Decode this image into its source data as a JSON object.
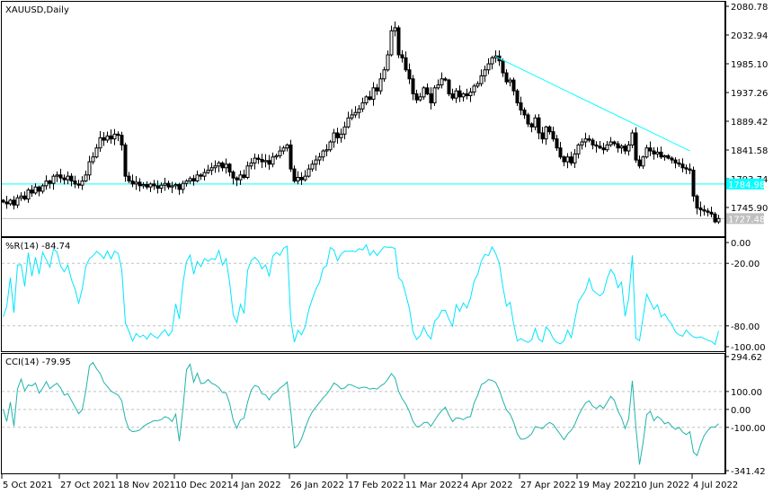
{
  "chart_data": [
    {
      "type": "candlestick",
      "title": "XAUUSD,Daily",
      "symbol": "XAUUSD",
      "timeframe": "Daily",
      "open_rule": "each open equals previous close",
      "close": [
        1755,
        1752,
        1758,
        1750,
        1762,
        1765,
        1760,
        1775,
        1770,
        1780,
        1773,
        1782,
        1790,
        1786,
        1798,
        1800,
        1795,
        1792,
        1798,
        1790,
        1785,
        1783,
        1790,
        1800,
        1822,
        1830,
        1845,
        1862,
        1858,
        1865,
        1860,
        1868,
        1866,
        1850,
        1798,
        1790,
        1785,
        1788,
        1782,
        1784,
        1780,
        1785,
        1782,
        1778,
        1783,
        1786,
        1780,
        1782,
        1784,
        1776,
        1786,
        1790,
        1794,
        1790,
        1800,
        1798,
        1804,
        1808,
        1812,
        1815,
        1820,
        1812,
        1818,
        1805,
        1795,
        1792,
        1800,
        1796,
        1815,
        1820,
        1828,
        1826,
        1822,
        1824,
        1818,
        1830,
        1832,
        1840,
        1845,
        1850,
        1810,
        1790,
        1796,
        1792,
        1798,
        1810,
        1818,
        1825,
        1830,
        1840,
        1842,
        1855,
        1870,
        1862,
        1868,
        1880,
        1895,
        1900,
        1904,
        1910,
        1920,
        1930,
        1926,
        1945,
        1940,
        1960,
        1975,
        2000,
        2040,
        2045,
        2000,
        1995,
        1975,
        1960,
        1935,
        1925,
        1930,
        1945,
        1935,
        1920,
        1945,
        1950,
        1960,
        1958,
        1935,
        1928,
        1940,
        1930,
        1935,
        1932,
        1938,
        1948,
        1952,
        1965,
        1975,
        1985,
        1995,
        1998,
        1990,
        1970,
        1955,
        1958,
        1940,
        1920,
        1908,
        1900,
        1885,
        1880,
        1895,
        1870,
        1860,
        1880,
        1872,
        1860,
        1845,
        1830,
        1822,
        1830,
        1820,
        1835,
        1850,
        1855,
        1860,
        1858,
        1850,
        1848,
        1845,
        1842,
        1850,
        1855,
        1852,
        1845,
        1848,
        1840,
        1850,
        1870,
        1825,
        1815,
        1830,
        1845,
        1840,
        1835,
        1838,
        1830,
        1832,
        1828,
        1825,
        1820,
        1818,
        1812,
        1810,
        1808,
        1765,
        1745,
        1742,
        1740,
        1738,
        1735,
        1722,
        1727.48
      ],
      "y_range": [
        1699.6,
        2080.78
      ],
      "y_ticks": [
        "2080.78",
        "2032.94",
        "1985.10",
        "1937.26",
        "1889.42",
        "1841.58",
        "1793.74",
        "1745.90"
      ],
      "x_ticks": [
        {
          "label": "5 Oct 2021",
          "bar": 0
        },
        {
          "label": "27 Oct 2021",
          "bar": 16
        },
        {
          "label": "18 Nov 2021",
          "bar": 32
        },
        {
          "label": "10 Dec 2021",
          "bar": 48
        },
        {
          "label": "4 Jan 2022",
          "bar": 64
        },
        {
          "label": "26 Jan 2022",
          "bar": 80
        },
        {
          "label": "17 Feb 2022",
          "bar": 96
        },
        {
          "label": "11 Mar 2022",
          "bar": 112
        },
        {
          "label": "4 Apr 2022",
          "bar": 128
        },
        {
          "label": "27 Apr 2022",
          "bar": 144
        },
        {
          "label": "19 May 2022",
          "bar": 160
        },
        {
          "label": "10 Jun 2022",
          "bar": 176
        },
        {
          "label": "4 Jul 2022",
          "bar": 192
        }
      ],
      "horizontal_line": {
        "price": 1784.98,
        "label": "1784.98",
        "color": "#00ffff"
      },
      "last_price": {
        "price": 1727.48,
        "label": "1727.48",
        "color": "#c0c0c0"
      },
      "trendline": {
        "from": {
          "bar": 137,
          "price": 1997
        },
        "to": {
          "bar": 191,
          "price": 1840
        },
        "color": "#00ffff"
      }
    },
    {
      "type": "line",
      "title": "%R(14) -84.74",
      "indicator": "Williams %R",
      "period": 14,
      "current": -84.74,
      "y_range": [
        -100,
        0
      ],
      "y_ticks": [
        "0.00",
        "-20.00",
        "-80.00",
        "-100.00"
      ],
      "levels": [
        -20,
        -80
      ],
      "color": "#00e5ff"
    },
    {
      "type": "line",
      "title": "CCI(14) -79.95",
      "indicator": "Commodity Channel Index",
      "period": 14,
      "current": -79.95,
      "y_range": [
        -341.42,
        294.62
      ],
      "y_ticks": [
        "294.62",
        "100.00",
        "0.00",
        "-100.00",
        "-341.42"
      ],
      "levels": [
        100,
        0,
        -100
      ],
      "color": "#20b2aa"
    }
  ]
}
